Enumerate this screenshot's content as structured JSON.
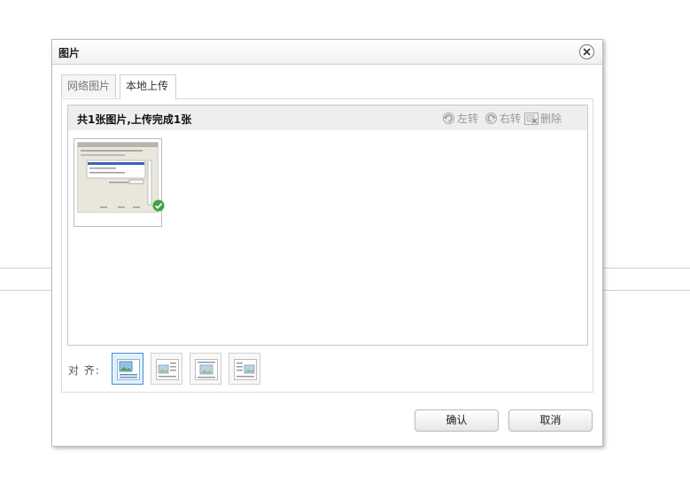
{
  "dialog": {
    "title": "图片",
    "ok_label": "确认",
    "cancel_label": "取消"
  },
  "tabs": [
    {
      "label": "网络图片",
      "active": false
    },
    {
      "label": "本地上传",
      "active": true
    }
  ],
  "upload": {
    "status": "共1张图片,上传完成1张",
    "rotate_left": "左转",
    "rotate_right": "右转",
    "delete": "删除"
  },
  "align": {
    "label": "对 齐:",
    "options": [
      {
        "icon": "align-none-icon",
        "selected": true
      },
      {
        "icon": "align-left-icon",
        "selected": false
      },
      {
        "icon": "align-center-icon",
        "selected": false
      },
      {
        "icon": "align-right-icon",
        "selected": false
      }
    ]
  },
  "colors": {
    "selected_border": "#3e8fd8",
    "check_green": "#3fa33f"
  }
}
